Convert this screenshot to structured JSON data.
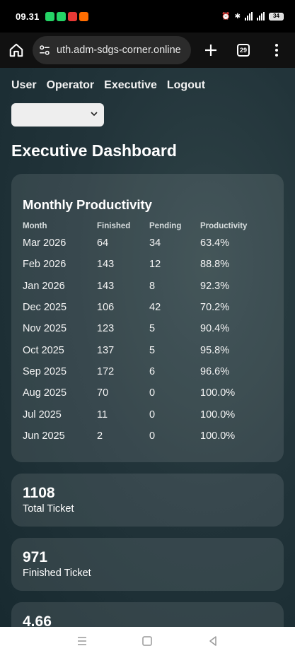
{
  "status": {
    "time": "09.31",
    "battery": "34"
  },
  "browser": {
    "url": "uth.adm-sdgs-corner.online",
    "tab_count": "29"
  },
  "nav": {
    "items": [
      "User",
      "Operator",
      "Executive",
      "Logout"
    ]
  },
  "select": {
    "value": ""
  },
  "page_title": "Executive Dashboard",
  "productivity": {
    "title": "Monthly Productivity",
    "columns": [
      "Month",
      "Finished",
      "Pending",
      "Productivity"
    ],
    "rows": [
      [
        "Mar 2026",
        "64",
        "34",
        "63.4%"
      ],
      [
        "Feb 2026",
        "143",
        "12",
        "88.8%"
      ],
      [
        "Jan 2026",
        "143",
        "8",
        "92.3%"
      ],
      [
        "Dec 2025",
        "106",
        "42",
        "70.2%"
      ],
      [
        "Nov 2025",
        "123",
        "5",
        "90.4%"
      ],
      [
        "Oct 2025",
        "137",
        "5",
        "95.8%"
      ],
      [
        "Sep 2025",
        "172",
        "6",
        "96.6%"
      ],
      [
        "Aug 2025",
        "70",
        "0",
        "100.0%"
      ],
      [
        "Jul 2025",
        "11",
        "0",
        "100.0%"
      ],
      [
        "Jun 2025",
        "2",
        "0",
        "100.0%"
      ]
    ]
  },
  "stats": [
    {
      "value": "1108",
      "label": "Total Ticket"
    },
    {
      "value": "971",
      "label": "Finished Ticket"
    },
    {
      "value": "4.66",
      "label": ""
    }
  ],
  "colors": {
    "page_bg": "#22343a",
    "card_bg": "rgba(255,255,255,0.1)"
  }
}
